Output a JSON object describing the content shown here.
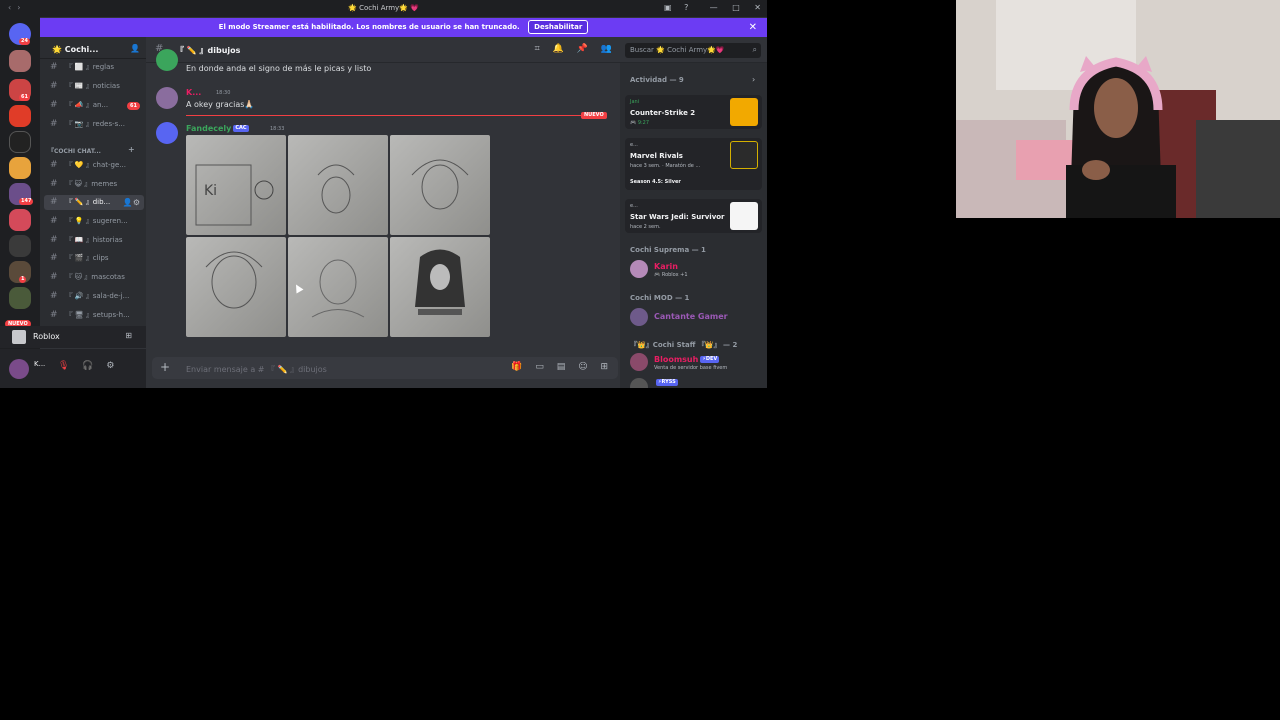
{
  "window": {
    "title": "🌟 Cochi Army🌟 💗",
    "controls": [
      "—",
      "□",
      "✕"
    ]
  },
  "banner": {
    "text": "El modo Streamer está habilitado. Los nombres de usuario se han truncado.",
    "button": "Deshabilitar",
    "close": "✕"
  },
  "guilds": {
    "badges": [
      "24",
      "61",
      "147",
      "1"
    ],
    "new_label": "NUEVO"
  },
  "server": {
    "name": "🌟 Cochi...",
    "channels": [
      {
        "label": "『 ⬜ 』reglas"
      },
      {
        "label": "『 📰 』noticias"
      },
      {
        "label": "『 📣 』an...",
        "count": "61"
      },
      {
        "label": "『 📷 』redes-s..."
      }
    ],
    "category": "『COCHI CHAT...",
    "channels2": [
      {
        "label": "『 💛 』chat-ge..."
      },
      {
        "label": "『 😺 』memes"
      },
      {
        "label": "『 ✏️ 』dib...",
        "active": true
      },
      {
        "label": "『 💡 』sugeren..."
      },
      {
        "label": "『 📖 』historias"
      },
      {
        "label": "『 🎬 』clips"
      },
      {
        "label": "『 🐱 』mascotas"
      },
      {
        "label": "『 🔊 』sala-de-j..."
      },
      {
        "label": "『 🖥 』setups-h..."
      }
    ]
  },
  "activity_bar": {
    "label": "Roblox"
  },
  "user": {
    "name": "K...",
    "status": "+1"
  },
  "channel": {
    "name": "『 ✏️ 』dibujos"
  },
  "search": {
    "placeholder": "Buscar 🌟 Cochi Army🌟💗"
  },
  "messages": {
    "m1_text": "En donde anda el signo de más le picas y listo",
    "m2_user": "K...",
    "m2_time": "18:30",
    "m2_text": "A okey gracias🙏🏻",
    "new_label": "NUEVO",
    "m3_user": "Fandecely",
    "m3_tag": "CAC",
    "m3_time": "18:33"
  },
  "composer": {
    "placeholder": "Enviar mensaje a # 『 ✏️ 』dibujos"
  },
  "members": {
    "activity_header": "Actividad — 9",
    "activities": [
      {
        "user": "Jani",
        "game": "Counter-Strike 2",
        "detail": "🎮 9:27"
      },
      {
        "user": "e...",
        "game": "Marvel Rivals",
        "detail": "hace 3 sem. · Maratón de ...",
        "extra": "Season 4.5: Silver"
      },
      {
        "user": "e...",
        "game": "Star Wars Jedi: Survivor",
        "detail": "hace 2 sem."
      }
    ],
    "groups": [
      {
        "header": "Cochi Suprema — 1",
        "name": "Karin",
        "status": "🎮 Roblox +1",
        "color": "#e91e63"
      },
      {
        "header": "Cochi MOD — 1",
        "name": "Cantante Gamer",
        "status": "",
        "color": "#9b59b6"
      },
      {
        "header": "『👑』Cochi Staff 『👑』 — 2",
        "name": "Bloomsuh",
        "status": "Venta de servidor base fivem",
        "color": "#e91e63",
        "tag": "⚡DEV"
      }
    ],
    "next_tag": "⚡RYSS"
  },
  "colors": {
    "accent": "#5865f2",
    "banner": "#6c3cf3",
    "danger": "#f23f43"
  }
}
